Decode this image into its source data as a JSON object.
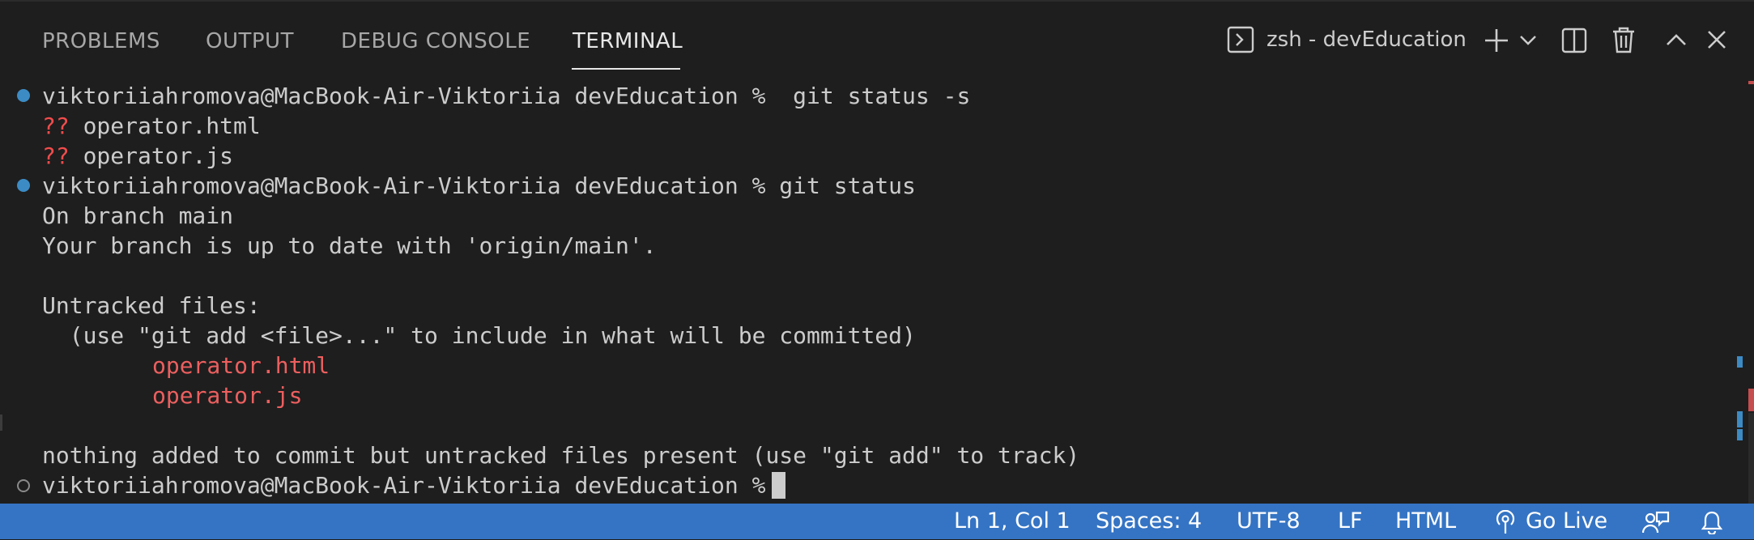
{
  "tabs": [
    {
      "label": "PROBLEMS"
    },
    {
      "label": "OUTPUT"
    },
    {
      "label": "DEBUG CONSOLE"
    },
    {
      "label": "TERMINAL",
      "active": true
    }
  ],
  "toolbar": {
    "terminal_name": "zsh - devEducation",
    "icons": [
      "terminal-icon",
      "plus-icon",
      "chevron-down-icon",
      "split-terminal-icon",
      "trash-icon",
      "chevron-up-icon",
      "close-icon"
    ]
  },
  "terminal": {
    "prompt": "viktoriiahromova@MacBook-Air-Viktoriia devEducation %",
    "cmd1": "  git status -s",
    "untracked_short_prefix": "??",
    "file1": "operator.html",
    "file2": "operator.js",
    "cmd2": " git status",
    "out_branch": "On branch main",
    "out_uptodate": "Your branch is up to date with 'origin/main'.",
    "out_untracked_header": "Untracked files:",
    "out_hint": "  (use \"git add <file>...\" to include in what will be committed)",
    "out_nothing": "nothing added to commit but untracked files present (use \"git add\" to track)"
  },
  "statusbar": {
    "position": "Ln 1, Col 1",
    "spaces": "Spaces: 4",
    "encoding": "UTF-8",
    "eol": "LF",
    "language": "HTML",
    "golive": "Go Live"
  },
  "colors": {
    "accent": "#3574c4",
    "error_red": "#f14c4c",
    "decoration_blue": "#3c8bc5",
    "background": "#1e1e1e"
  }
}
